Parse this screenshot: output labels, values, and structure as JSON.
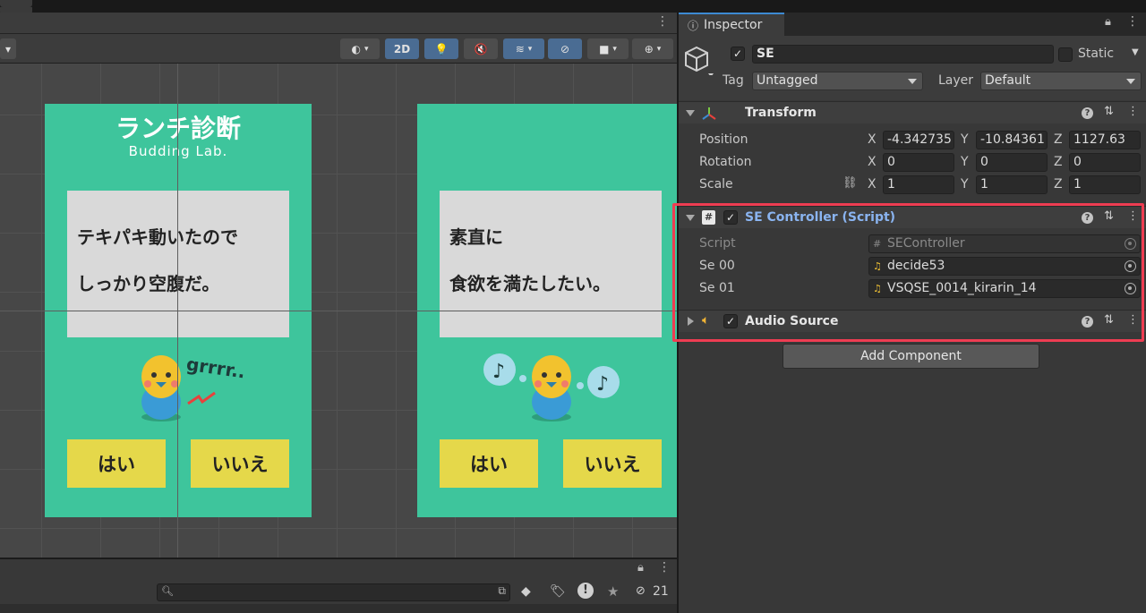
{
  "scene": {
    "toolbar": {
      "mode_2d": "2D"
    },
    "card1": {
      "title": "ランチ診断",
      "subtitle": "Budding Lab.",
      "line1": "テキパキ動いたので",
      "line2": "しっかり空腹だ。",
      "sound_text": "grrrr..",
      "yes": "はい",
      "no": "いいえ"
    },
    "card2": {
      "line1": "素直に",
      "line2": "食欲を満たしたい。",
      "yes": "はい",
      "no": "いいえ"
    }
  },
  "project_bar": {
    "hidden_count": "21"
  },
  "inspector": {
    "tab_label": "Inspector",
    "object": {
      "name": "SE",
      "active": true,
      "static_label": "Static",
      "tag_label": "Tag",
      "tag_value": "Untagged",
      "layer_label": "Layer",
      "layer_value": "Default"
    },
    "transform": {
      "title": "Transform",
      "position_label": "Position",
      "rotation_label": "Rotation",
      "scale_label": "Scale",
      "axis_x": "X",
      "axis_y": "Y",
      "axis_z": "Z",
      "position": {
        "x": "-4.342735",
        "y": "-10.84361",
        "z": "1127.63"
      },
      "rotation": {
        "x": "0",
        "y": "0",
        "z": "0"
      },
      "scale": {
        "x": "1",
        "y": "1",
        "z": "1"
      }
    },
    "se_controller": {
      "title": "SE Controller (Script)",
      "script_label": "Script",
      "script_value": "SEController",
      "se00_label": "Se 00",
      "se00_value": "decide53",
      "se01_label": "Se 01",
      "se01_value": "VSQSE_0014_kirarin_14"
    },
    "audio_source": {
      "title": "Audio Source"
    },
    "add_component": "Add Component"
  },
  "colors": {
    "accent": "#4a6c93",
    "highlight": "#ee3d52",
    "card_green": "#3ec59c",
    "button_yellow": "#e5d84a",
    "script_title": "#8ab4f0"
  }
}
